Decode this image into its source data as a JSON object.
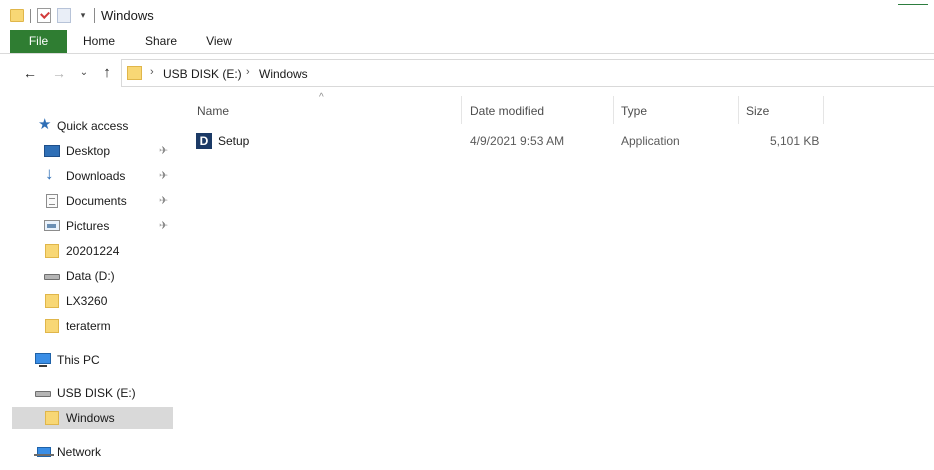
{
  "window": {
    "title": "Windows"
  },
  "quick_access_toolbar": {
    "icons": [
      "folder-icon",
      "properties-icon",
      "new-folder-icon",
      "customize-dropdown-icon"
    ]
  },
  "ribbon": {
    "tabs": [
      {
        "label": "File",
        "active": true,
        "color": "#2f7d32"
      },
      {
        "label": "Home"
      },
      {
        "label": "Share"
      },
      {
        "label": "View"
      }
    ]
  },
  "address_bar": {
    "breadcrumbs": [
      "USB DISK (E:)",
      "Windows"
    ],
    "separator": "›"
  },
  "navigation": {
    "back_glyph": "←",
    "forward_glyph": "→",
    "recent_glyph": "⌄",
    "up_glyph": "↑"
  },
  "sidebar": {
    "items": [
      {
        "label": "Quick access",
        "icon": "star-icon"
      },
      {
        "label": "Desktop",
        "icon": "desktop-icon",
        "pinned": true
      },
      {
        "label": "Downloads",
        "icon": "download-icon",
        "pinned": true
      },
      {
        "label": "Documents",
        "icon": "documents-icon",
        "pinned": true
      },
      {
        "label": "Pictures",
        "icon": "pictures-icon",
        "pinned": true
      },
      {
        "label": "20201224",
        "icon": "folder-icon"
      },
      {
        "label": "Data (D:)",
        "icon": "drive-icon"
      },
      {
        "label": "LX3260",
        "icon": "folder-icon"
      },
      {
        "label": "teraterm",
        "icon": "folder-icon"
      },
      {
        "label": "This PC",
        "icon": "pc-icon"
      },
      {
        "label": "USB DISK (E:)",
        "icon": "drive-icon"
      },
      {
        "label": "Windows",
        "icon": "folder-icon",
        "selected": true
      },
      {
        "label": "Network",
        "icon": "network-icon"
      }
    ],
    "pin_glyph": "✈"
  },
  "columns": {
    "name": "Name",
    "date_modified": "Date modified",
    "type": "Type",
    "size": "Size",
    "sort_glyph": "^"
  },
  "files": [
    {
      "name": "Setup",
      "date_modified": "4/9/2021 9:53 AM",
      "type": "Application",
      "size": "5,101 KB",
      "icon": "app-icon",
      "icon_letter": "D"
    }
  ]
}
